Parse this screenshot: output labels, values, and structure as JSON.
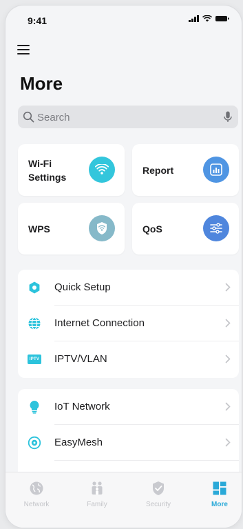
{
  "status_bar": {
    "time": "9:41"
  },
  "page": {
    "title": "More"
  },
  "search": {
    "placeholder": "Search"
  },
  "tiles": [
    {
      "label_line1": "Wi-Fi",
      "label_line2": "Settings",
      "icon": "wifi-icon",
      "color": "#33c6dc"
    },
    {
      "label": "Report",
      "icon": "chart-icon",
      "color": "#4f95e3"
    },
    {
      "label": "WPS",
      "icon": "shield-wifi-icon",
      "color": "#86b9c9"
    },
    {
      "label": "QoS",
      "icon": "sliders-icon",
      "color": "#4f86dd"
    }
  ],
  "list_group_1": [
    {
      "label": "Quick Setup",
      "icon": "quick-setup-icon"
    },
    {
      "label": "Internet Connection",
      "icon": "globe-icon"
    },
    {
      "label": "IPTV/VLAN",
      "icon": "iptv-icon",
      "icon_text": "IPTV"
    }
  ],
  "list_group_2": [
    {
      "label": "IoT Network",
      "icon": "lightbulb-icon"
    },
    {
      "label": "EasyMesh",
      "icon": "easymesh-icon"
    }
  ],
  "tabbar": {
    "tabs": [
      {
        "label": "Network",
        "icon": "globe-icon"
      },
      {
        "label": "Family",
        "icon": "family-icon"
      },
      {
        "label": "Security",
        "icon": "shield-icon"
      },
      {
        "label": "More",
        "icon": "grid-icon",
        "active": true
      }
    ]
  },
  "colors": {
    "accent": "#2aa9d8",
    "background": "#f4f5f7"
  }
}
